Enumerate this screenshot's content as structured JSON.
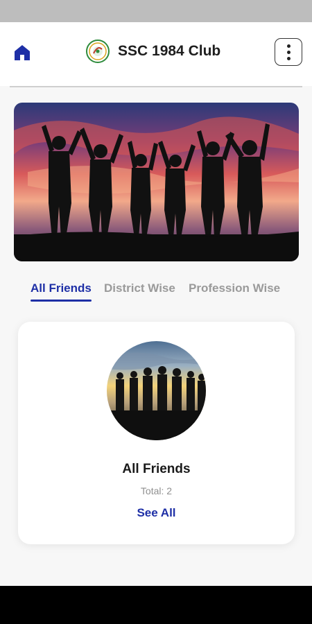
{
  "header": {
    "title": "SSC 1984 Club",
    "home_icon": "home-icon",
    "menu_icon": "more-vertical-icon",
    "accent": "#1e2fa6"
  },
  "tabs": [
    {
      "label": "All Friends",
      "active": true
    },
    {
      "label": "District Wise",
      "active": false
    },
    {
      "label": "Profession Wise",
      "active": false
    }
  ],
  "card": {
    "title": "All Friends",
    "total": "Total: 2",
    "see_all": "See All"
  }
}
